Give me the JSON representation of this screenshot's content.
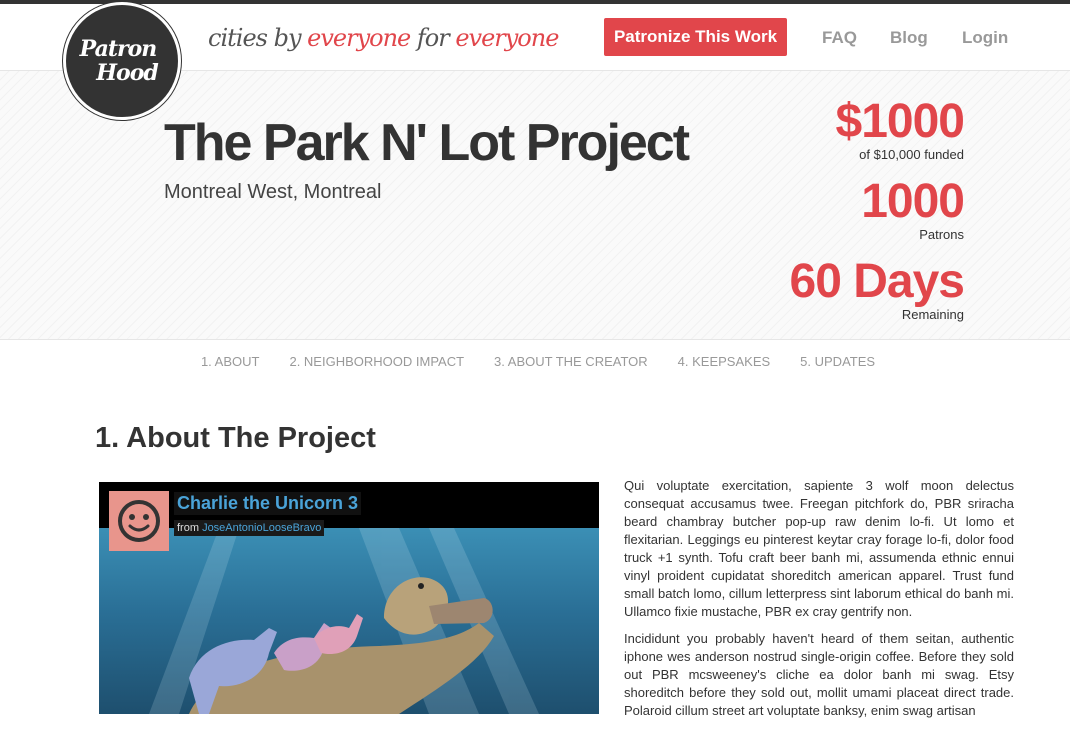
{
  "brand": {
    "logo_line1": "Patron",
    "logo_line2": "Hood",
    "tagline_part1": "cities by ",
    "tagline_red1": "everyone",
    "tagline_part2": " for ",
    "tagline_red2": "everyone"
  },
  "nav": {
    "cta_label": "Patronize This Work",
    "links": [
      "FAQ",
      "Blog",
      "Login"
    ]
  },
  "project": {
    "title": "The Park N' Lot Project",
    "location": "Montreal West, Montreal",
    "stats": [
      {
        "value": "$1000",
        "label": "of $10,000 funded"
      },
      {
        "value": "1000",
        "label": "Patrons"
      },
      {
        "value": "60 Days",
        "label": "Remaining"
      }
    ]
  },
  "tabs": [
    "1. ABOUT",
    "2. NEIGHBORHOOD IMPACT",
    "3. ABOUT THE CREATOR",
    "4. KEEPSAKES",
    "5. UPDATES"
  ],
  "section": {
    "title": "1. About The Project"
  },
  "video": {
    "title": "Charlie the Unicorn 3",
    "from_label": "from ",
    "author": "JoseAntonioLooseBravo"
  },
  "paragraphs": [
    "Qui voluptate exercitation, sapiente 3 wolf moon delectus consequat accusamus twee. Freegan pitchfork do, PBR sriracha beard chambray butcher pop-up raw denim lo-fi. Ut lomo et flexitarian. Leggings eu pinterest keytar cray forage lo-fi, dolor food truck +1 synth. Tofu craft beer banh mi, assumenda ethnic ennui vinyl proident cupidatat shoreditch american apparel. Trust fund small batch lomo, cillum letterpress sint laborum ethical do banh mi. Ullamco fixie mustache, PBR ex cray gentrify non.",
    "Incididunt you probably haven't heard of them seitan, authentic iphone wes anderson nostrud single-origin coffee. Before they sold out PBR mcsweeney's cliche ea dolor banh mi swag. Etsy shoreditch before they sold out, mollit umami placeat direct trade. Polaroid cillum street art voluptate banksy, enim swag artisan"
  ],
  "colors": {
    "accent": "#e1464b",
    "dark": "#333333",
    "muted": "#999999",
    "link_blue": "#4aa3d8"
  }
}
